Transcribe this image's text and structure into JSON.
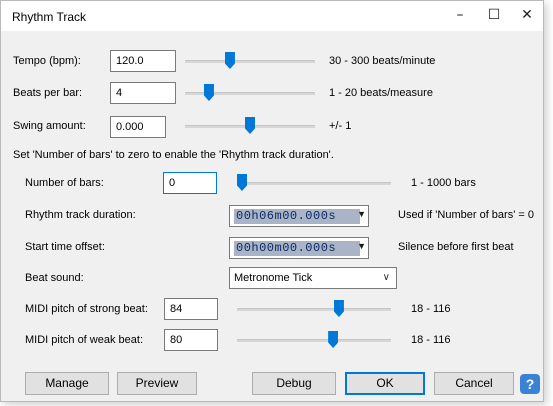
{
  "window": {
    "title": "Rhythm Track",
    "minimize_glyph": "–",
    "maximize_glyph": "☐",
    "close_glyph": "✕"
  },
  "tempo": {
    "label": "Tempo (bpm):",
    "value": "120.0",
    "range": "30 - 300 beats/minute",
    "slider_fraction": 0.333
  },
  "beats_per_bar": {
    "label": "Beats per bar:",
    "value": "4",
    "range": "1 - 20 beats/measure",
    "slider_fraction": 0.158
  },
  "swing": {
    "label": "Swing amount:",
    "value": "0.000",
    "range": "+/- 1",
    "slider_fraction": 0.5
  },
  "note": "Set 'Number of bars' to zero to enable the 'Rhythm track duration'.",
  "number_of_bars": {
    "label": "Number of bars:",
    "value": "0",
    "range": "1 - 1000 bars",
    "slider_fraction": 0.0
  },
  "duration": {
    "label": "Rhythm track duration:",
    "value": "00h06m00.000s",
    "hint": "Used if 'Number of bars' = 0"
  },
  "start_offset": {
    "label": "Start time offset:",
    "value": "00h00m00.000s",
    "hint": "Silence before first beat"
  },
  "beat_sound": {
    "label": "Beat sound:",
    "selected": "Metronome Tick"
  },
  "midi_strong": {
    "label": "MIDI pitch of strong beat:",
    "value": "84",
    "range": "18 - 116",
    "slider_fraction": 0.673
  },
  "midi_weak": {
    "label": "MIDI pitch of weak beat:",
    "value": "80",
    "range": "18 - 116",
    "slider_fraction": 0.633
  },
  "buttons": {
    "manage": "Manage",
    "preview": "Preview",
    "debug": "Debug",
    "ok": "OK",
    "cancel": "Cancel",
    "help": "?"
  },
  "colors": {
    "accent": "#0078d7",
    "dialog_bg": "#f0f0f0",
    "time_field_bg": "#a9b4c6"
  }
}
